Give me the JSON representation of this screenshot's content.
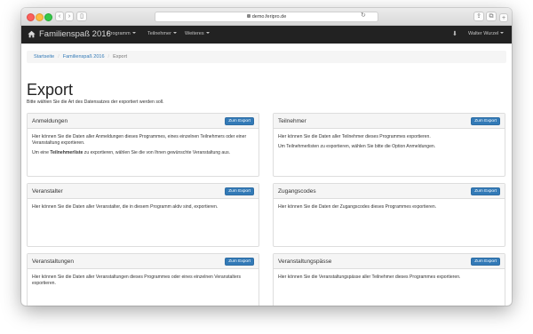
{
  "browser": {
    "url": "demo.feripro.de"
  },
  "navbar": {
    "brand": "Familienspaß 2016",
    "items": [
      {
        "label": "Programm"
      },
      {
        "label": "Teilnehmer"
      },
      {
        "label": "Weiteres"
      }
    ],
    "user": "Walter Wurzel"
  },
  "breadcrumb": {
    "items": [
      "Startseite",
      "Familienspaß 2016",
      "Export"
    ]
  },
  "page": {
    "title": "Export",
    "intro": "Bitte wählen Sie die Art des Datensatzes der exportiert werden soll."
  },
  "panels": [
    {
      "title": "Anmeldungen",
      "button": "Zum Export",
      "p1": "Hier können Sie die Daten aller Anmeldungen dieses Programmes, eines einzelnen Teilnehmers oder einer Veranstaltung exportieren.",
      "p2_pre": "Um eine ",
      "p2_bold": "Teilnehmerliste",
      "p2_post": " zu exportieren, wählen Sie die von Ihnen gewünschte Veranstaltung aus."
    },
    {
      "title": "Teilnehmer",
      "button": "Zum Export",
      "p1": "Hier können Sie die Daten aller Teilnehmer dieses Programmes exportieren.",
      "p2": "Um Teilnehmerlisten zu exportieren, wählen Sie bitte die Option Anmeldungen."
    },
    {
      "title": "Veranstalter",
      "button": "Zum Export",
      "p1": "Hier können Sie die Daten aller Veranstalter, die in diesem Programm aktiv sind, exportieren."
    },
    {
      "title": "Zugangscodes",
      "button": "Zum Export",
      "p1": "Hier können Sie die Daten der Zugangscodes dieses Programmes exportieren."
    },
    {
      "title": "Veranstaltungen",
      "button": "Zum Export",
      "p1": "Hier können Sie die Daten aller Veranstaltungen dieses Programmes oder eines einzelnen Veranstalters exportieren."
    },
    {
      "title": "Veranstaltungspässe",
      "button": "Zum Export",
      "p1": "Hier können Sie die Veranstaltungspässe aller Teilnehmer dieses Programmes exportieren."
    }
  ],
  "colors": {
    "navbar": "#222222",
    "primary": "#337ab7",
    "link": "#337ab7"
  }
}
